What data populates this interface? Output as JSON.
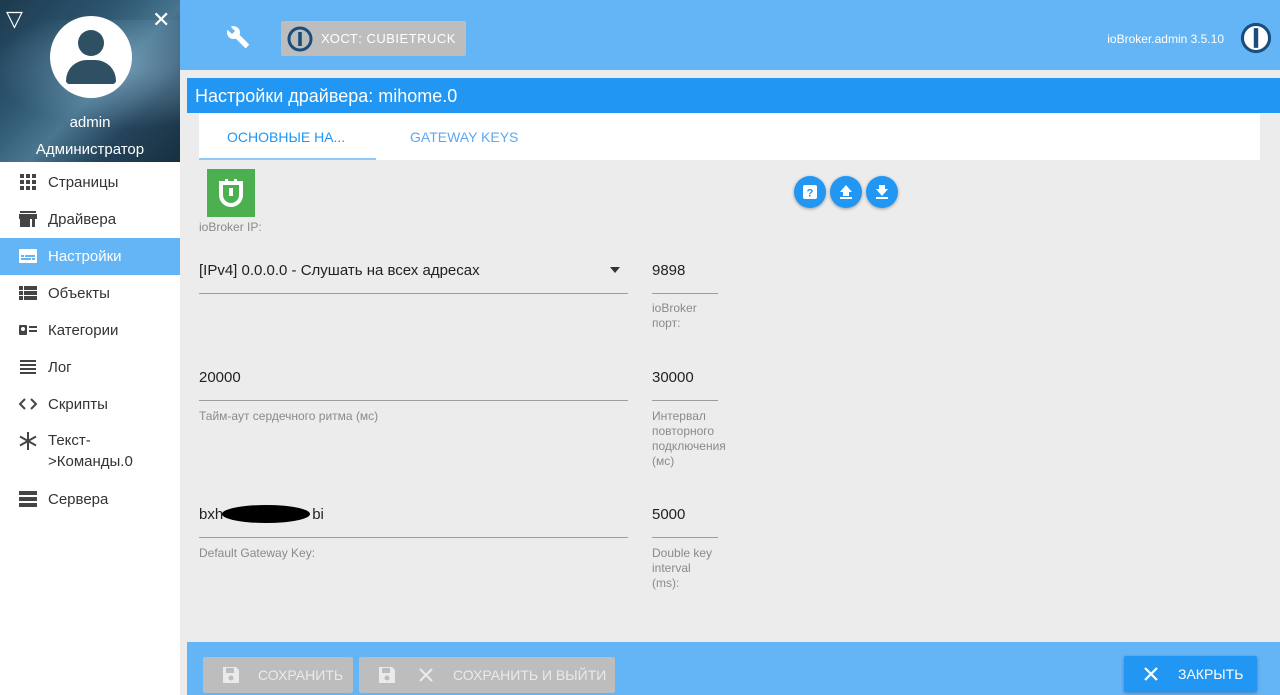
{
  "sidebar": {
    "user_name": "admin",
    "user_role": "Администратор",
    "items": [
      {
        "label": "Страницы",
        "icon": "grid-icon"
      },
      {
        "label": "Драйвера",
        "icon": "store-icon"
      },
      {
        "label": "Настройки",
        "icon": "settings-panel-icon"
      },
      {
        "label": "Объекты",
        "icon": "list-icon"
      },
      {
        "label": "Категории",
        "icon": "category-icon"
      },
      {
        "label": "Лог",
        "icon": "log-icon"
      },
      {
        "label": "Скрипты",
        "icon": "code-icon"
      },
      {
        "label": "Текст-\n>Команды.0",
        "icon": "snowflake-icon"
      },
      {
        "label": "Сервера",
        "icon": "servers-icon"
      }
    ],
    "active_index": 2
  },
  "topbar": {
    "host_label": "ХОСТ: CUBIETRUCK",
    "version": "ioBroker.admin 3.5.10"
  },
  "main": {
    "title": "Настройки драйвера: mihome.0",
    "tabs": [
      "ОСНОВНЫЕ НА...",
      "GATEWAY KEYS"
    ],
    "active_tab": 0
  },
  "form": {
    "bind_label": "ioBroker IP:",
    "bind_value": "[IPv4] 0.0.0.0 - Слушать на всех адресах",
    "port_value": "9898",
    "port_label": "ioBroker\nпорт:",
    "heartbeat_value": "20000",
    "heartbeat_label": "Тайм-аут сердечного ритма (мс)",
    "reconnect_value": "30000",
    "reconnect_label": "Интервал\nповторного\nподключения\n(мс)",
    "key_value": "bxh",
    "key_value_end": "bi",
    "key_label": "Default Gateway Key:",
    "double_value": "5000",
    "double_label": "Double key\ninterval\n(ms):"
  },
  "footer": {
    "save": "СОХРАНИТЬ",
    "save_close": "СОХРАНИТЬ И ВЫЙТИ",
    "close": "ЗАКРЫТЬ"
  },
  "colors": {
    "primary": "#2196f3",
    "light_primary": "#64b5f6",
    "mi_green": "#4caf50"
  }
}
